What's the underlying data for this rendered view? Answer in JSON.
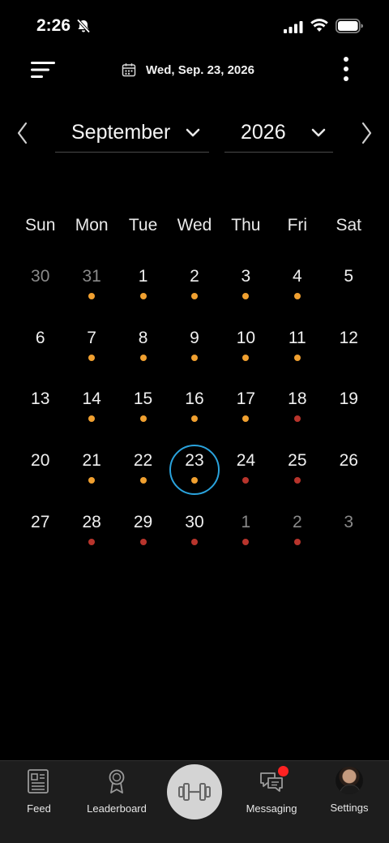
{
  "status_bar": {
    "time": "2:26"
  },
  "header": {
    "current_date": "Wed, Sep. 23, 2026"
  },
  "selectors": {
    "month": "September",
    "year": "2026"
  },
  "weekdays": [
    "Sun",
    "Mon",
    "Tue",
    "Wed",
    "Thu",
    "Fri",
    "Sat"
  ],
  "colors": {
    "dot_orange": "#f0a030",
    "dot_red": "#b8342c",
    "selected_ring": "#2aa3dd"
  },
  "calendar": {
    "days": [
      {
        "day": "30",
        "other": true,
        "dot": null
      },
      {
        "day": "31",
        "other": true,
        "dot": "orange"
      },
      {
        "day": "1",
        "other": false,
        "dot": "orange"
      },
      {
        "day": "2",
        "other": false,
        "dot": "orange"
      },
      {
        "day": "3",
        "other": false,
        "dot": "orange"
      },
      {
        "day": "4",
        "other": false,
        "dot": "orange"
      },
      {
        "day": "5",
        "other": false,
        "dot": null
      },
      {
        "day": "6",
        "other": false,
        "dot": null
      },
      {
        "day": "7",
        "other": false,
        "dot": "orange"
      },
      {
        "day": "8",
        "other": false,
        "dot": "orange"
      },
      {
        "day": "9",
        "other": false,
        "dot": "orange"
      },
      {
        "day": "10",
        "other": false,
        "dot": "orange"
      },
      {
        "day": "11",
        "other": false,
        "dot": "orange"
      },
      {
        "day": "12",
        "other": false,
        "dot": null
      },
      {
        "day": "13",
        "other": false,
        "dot": null
      },
      {
        "day": "14",
        "other": false,
        "dot": "orange"
      },
      {
        "day": "15",
        "other": false,
        "dot": "orange"
      },
      {
        "day": "16",
        "other": false,
        "dot": "orange"
      },
      {
        "day": "17",
        "other": false,
        "dot": "orange"
      },
      {
        "day": "18",
        "other": false,
        "dot": "red"
      },
      {
        "day": "19",
        "other": false,
        "dot": null
      },
      {
        "day": "20",
        "other": false,
        "dot": null
      },
      {
        "day": "21",
        "other": false,
        "dot": "orange"
      },
      {
        "day": "22",
        "other": false,
        "dot": "orange"
      },
      {
        "day": "23",
        "other": false,
        "dot": "orange",
        "selected": true
      },
      {
        "day": "24",
        "other": false,
        "dot": "red"
      },
      {
        "day": "25",
        "other": false,
        "dot": "red"
      },
      {
        "day": "26",
        "other": false,
        "dot": null
      },
      {
        "day": "27",
        "other": false,
        "dot": null
      },
      {
        "day": "28",
        "other": false,
        "dot": "red"
      },
      {
        "day": "29",
        "other": false,
        "dot": "red"
      },
      {
        "day": "30",
        "other": false,
        "dot": "red"
      },
      {
        "day": "1",
        "other": true,
        "dot": "red"
      },
      {
        "day": "2",
        "other": true,
        "dot": "red"
      },
      {
        "day": "3",
        "other": true,
        "dot": null
      }
    ]
  },
  "tabbar": {
    "feed": "Feed",
    "leaderboard": "Leaderboard",
    "messaging": "Messaging",
    "settings": "Settings",
    "icons": {
      "feed": "newspaper-icon",
      "leaderboard": "award-ribbon-icon",
      "center": "dumbbell-icon",
      "messaging": "chat-bubbles-icon",
      "settings": "avatar"
    }
  }
}
